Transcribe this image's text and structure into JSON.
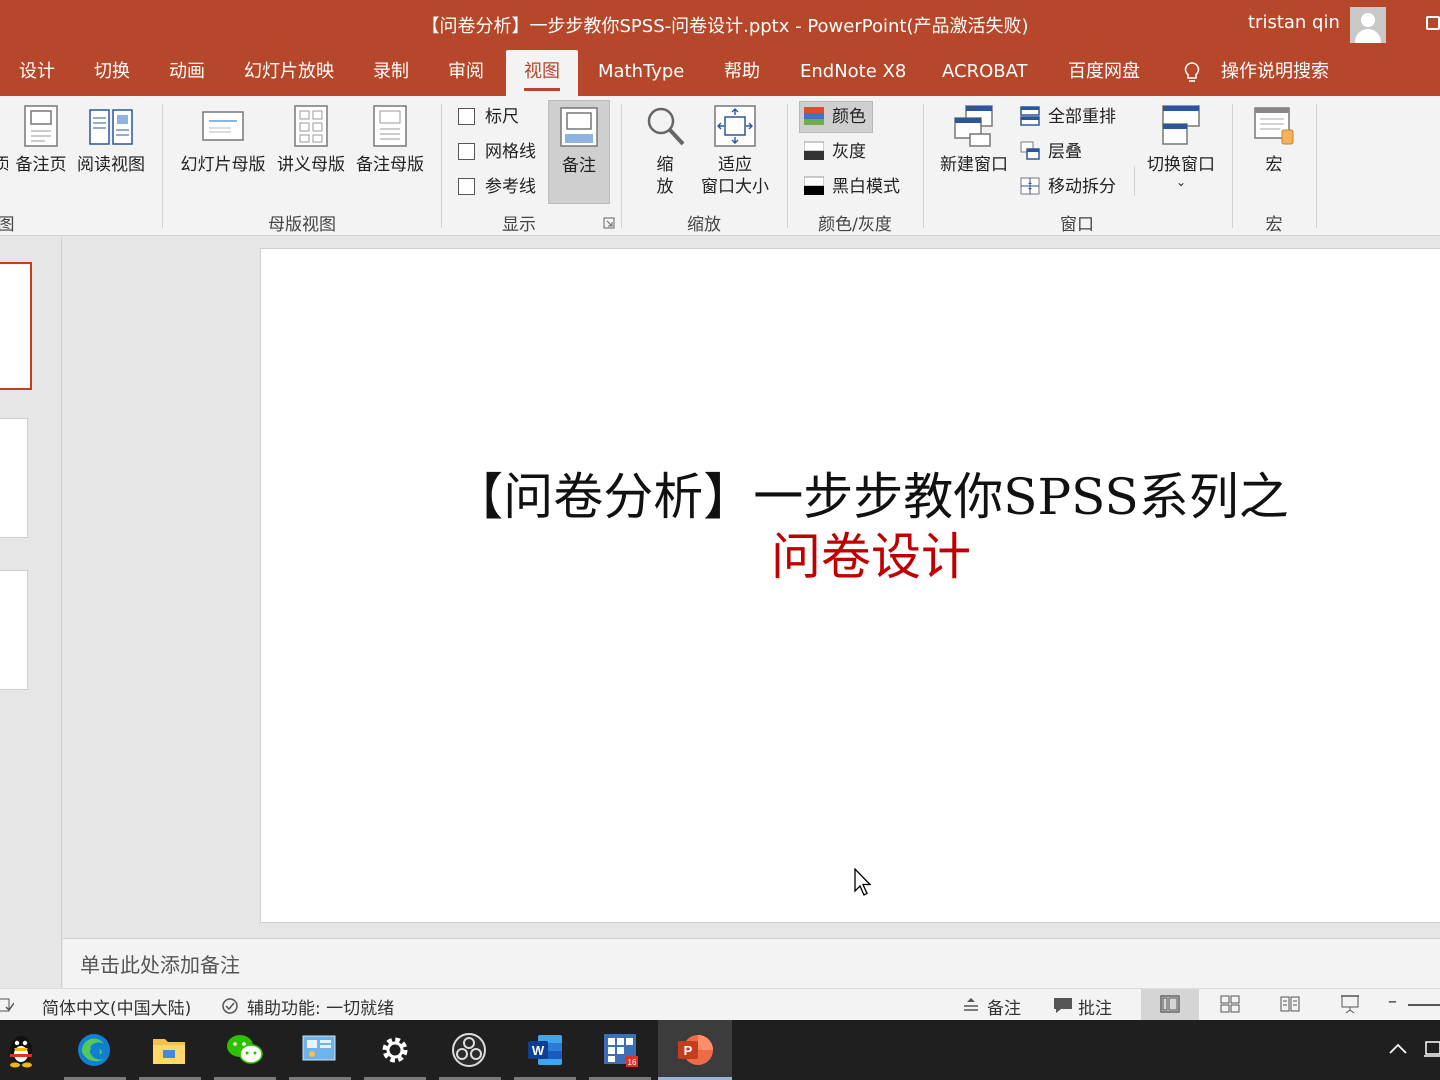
{
  "window": {
    "title": "【问卷分析】一步步教你SPSS-问卷设计.pptx  -  PowerPoint(产品激活失败)",
    "user": "tristan qin"
  },
  "tabs": [
    "设计",
    "切换",
    "动画",
    "幻灯片放映",
    "录制",
    "审阅",
    "视图",
    "MathType",
    "帮助",
    "EndNote X8",
    "ACROBAT",
    "百度网盘",
    "操作说明搜索"
  ],
  "active_tab": "视图",
  "ribbon": {
    "presentation_views": {
      "partial_btn": "页",
      "notes_page": "备注页",
      "reading_view": "阅读视图",
      "group_label": "图"
    },
    "master_views": {
      "slide_master": "幻灯片母版",
      "handout_master": "讲义母版",
      "notes_master": "备注母版",
      "group_label": "母版视图"
    },
    "show": {
      "ruler": "标尺",
      "gridlines": "网格线",
      "guides": "参考线",
      "notes": "备注",
      "group_label": "显示"
    },
    "zoom": {
      "zoom_line1": "缩",
      "zoom_line2": "放",
      "fit_line1": "适应",
      "fit_line2": "窗口大小",
      "group_label": "缩放"
    },
    "color": {
      "color": "颜色",
      "grayscale": "灰度",
      "black_white": "黑白模式",
      "group_label": "颜色/灰度"
    },
    "window": {
      "new_window": "新建窗口",
      "arrange_all": "全部重排",
      "cascade": "层叠",
      "move_split": "移动拆分",
      "switch_windows": "切换窗口",
      "group_label": "窗口"
    },
    "macros": {
      "macros": "宏",
      "group_label": "宏"
    }
  },
  "slide": {
    "title_line1": "【问卷分析】一步步教你SPSS系列之",
    "title_line2": "问卷设计"
  },
  "notes": {
    "placeholder": "单击此处添加备注"
  },
  "status": {
    "language": "简体中文(中国大陆)",
    "accessibility": "辅助功能: 一切就绪",
    "notes_btn": "备注",
    "comments_btn": "批注",
    "minus": "–"
  },
  "colors": {
    "accent": "#b7472a",
    "title_red": "#c00000"
  }
}
